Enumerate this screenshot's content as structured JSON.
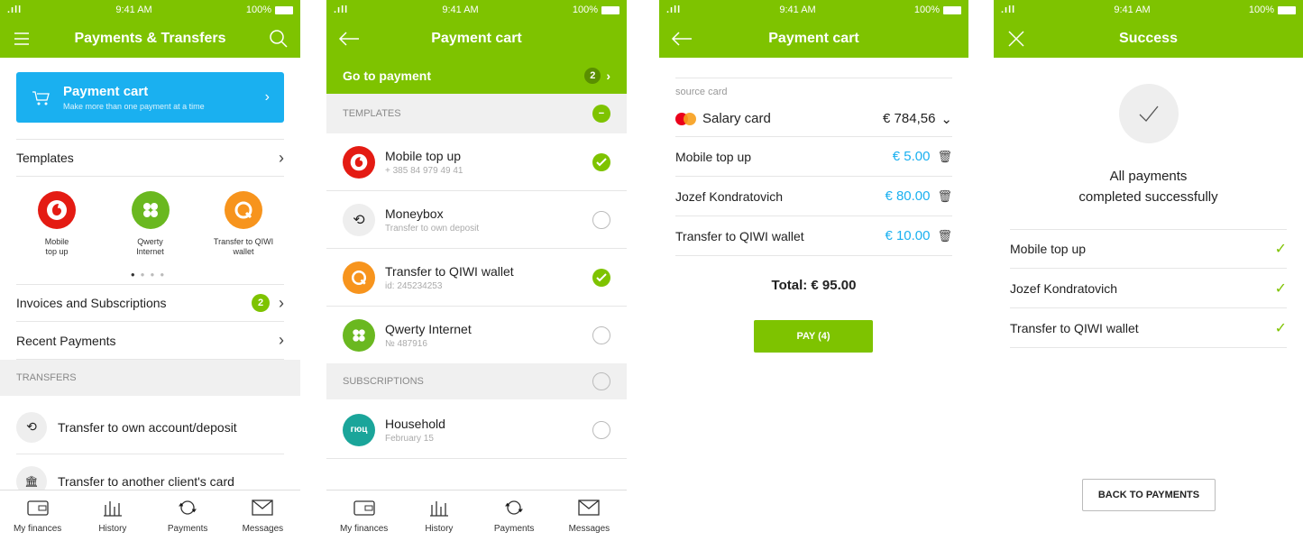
{
  "status": {
    "time": "9:41 AM",
    "battery": "100%"
  },
  "colors": {
    "accent": "#7ec300",
    "blue": "#1ab0f0"
  },
  "screen1": {
    "title": "Payments & Transfers",
    "cart_title": "Payment cart",
    "cart_subtitle": "Make more than one payment at a time",
    "templates_label": "Templates",
    "templates": [
      {
        "name": "Mobile\ntop up",
        "icon": "vodafone-icon"
      },
      {
        "name": "Qwerty\nInternet",
        "icon": "clover-icon"
      },
      {
        "name": "Transfer to QIWI\nwallet",
        "icon": "qiwi-icon"
      }
    ],
    "invoices_label": "Invoices and Subscriptions",
    "invoices_badge": "2",
    "recent_label": "Recent Payments",
    "transfers_header": "TRANSFERS",
    "transfer_own": "Transfer to own account/deposit",
    "transfer_client": "Transfer to another client's card"
  },
  "tabs": [
    "My finances",
    "History",
    "Payments",
    "Messages"
  ],
  "screen2": {
    "title": "Payment cart",
    "go_to_payment": "Go to payment",
    "go_badge": "2",
    "templates_header": "TEMPLATES",
    "items": [
      {
        "title": "Mobile top up",
        "sub": "+ 385 84 979 49 41",
        "checked": true
      },
      {
        "title": "Moneybox",
        "sub": "Transfer to own deposit",
        "checked": false
      },
      {
        "title": "Transfer to QIWI wallet",
        "sub": "id: 245234253",
        "checked": true
      },
      {
        "title": "Qwerty Internet",
        "sub": "№ 487916",
        "checked": false
      }
    ],
    "subscriptions_header": "SUBSCRIPTIONS",
    "subscription": {
      "title": "Household",
      "sub": "February 15",
      "logo": "гюц",
      "checked": false
    }
  },
  "screen3": {
    "title": "Payment cart",
    "source_label": "source card",
    "card_name": "Salary card",
    "card_amount": "€ 784,56",
    "payments": [
      {
        "name": "Mobile top up",
        "amount": "€ 5.00"
      },
      {
        "name": "Jozef Kondratovich",
        "amount": "€ 80.00"
      },
      {
        "name": "Transfer to QIWI wallet",
        "amount": "€ 10.00"
      }
    ],
    "total": "Total: € 95.00",
    "pay_button": "PAY (4)"
  },
  "screen4": {
    "title": "Success",
    "message_line1": "All payments",
    "message_line2": "completed successfully",
    "items": [
      "Mobile top up",
      "Jozef Kondratovich",
      "Transfer to QIWI wallet"
    ],
    "back_button": "BACK TO PAYMENTS"
  }
}
